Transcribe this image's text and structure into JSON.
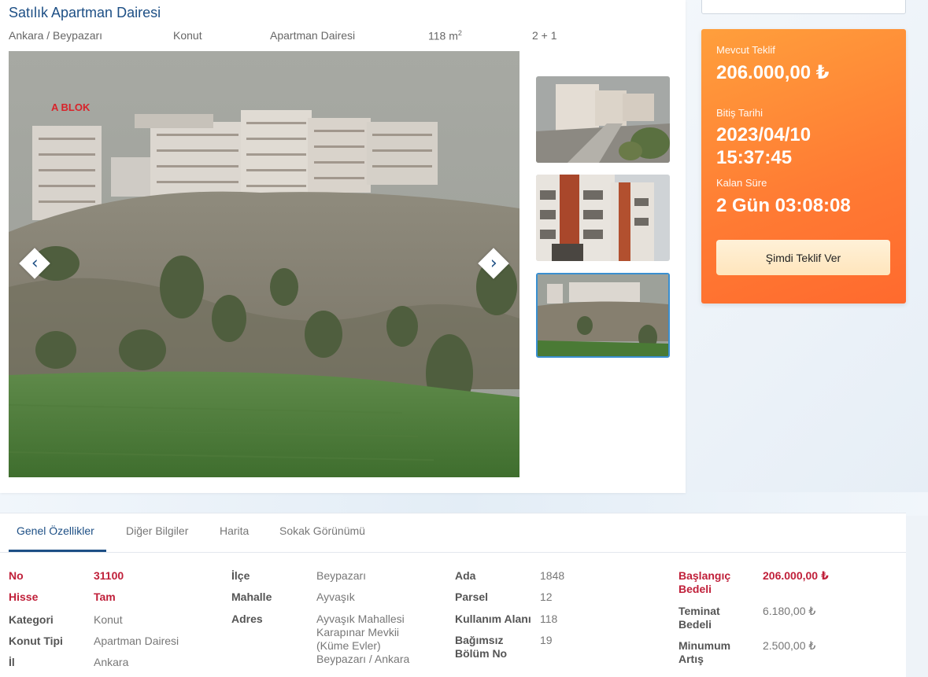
{
  "listing": {
    "title": "Satılık Apartman Dairesi",
    "location": "Ankara / Beypazarı",
    "type": "Konut",
    "subtype": "Apartman Dairesi",
    "area_number": "118 m",
    "area_sup": "2",
    "rooms": "2 + 1"
  },
  "gallery": {
    "photo_sign": "A BLOK",
    "thumbnails": 3,
    "active_thumbnail": 3
  },
  "offer": {
    "current_label": "Mevcut Teklif",
    "current_value": "206.000,00 ₺",
    "end_label": "Bitiş Tarihi",
    "end_date": "2023/04/10",
    "end_time": "15:37:45",
    "remaining_label": "Kalan Süre",
    "remaining_value": "2 Gün 03:08:08",
    "button_label": "Şimdi Teklif Ver"
  },
  "tabs": [
    "Genel Özellikler",
    "Diğer Bilgiler",
    "Harita",
    "Sokak Görünümü"
  ],
  "properties": {
    "col1": [
      {
        "key": "No",
        "value": "31100"
      },
      {
        "key": "Hisse",
        "value": "Tam"
      },
      {
        "key": "Kategori",
        "value": "Konut"
      },
      {
        "key": "Konut Tipi",
        "value": "Apartman Dairesi"
      },
      {
        "key": "İl",
        "value": "Ankara"
      }
    ],
    "col2": [
      {
        "key": "İlçe",
        "value": "Beypazarı"
      },
      {
        "key": "Mahalle",
        "value": "Ayvaşık"
      },
      {
        "key": "Adres",
        "value_lines": [
          "Ayvaşık Mahallesi",
          "Karapınar Mevkii",
          "(Küme Evler)",
          "Beypazarı / Ankara"
        ]
      }
    ],
    "col3": [
      {
        "key": "Ada",
        "value": "1848"
      },
      {
        "key": "Parsel",
        "value": "12"
      },
      {
        "key": "Kullanım Alanı",
        "value": "118"
      },
      {
        "key_lines": [
          "Bağımsız",
          "Bölüm No"
        ],
        "value": "19"
      }
    ],
    "col4": [
      {
        "key_lines": [
          "Başlangıç",
          "Bedeli"
        ],
        "value": "206.000,00 ₺"
      },
      {
        "key_lines": [
          "Teminat",
          "Bedeli"
        ],
        "value": "6.180,00 ₺"
      },
      {
        "key_lines": [
          "Minumum",
          "Artış"
        ],
        "value": "2.500,00 ₺"
      }
    ]
  },
  "colors": {
    "title_blue": "#1d4f85",
    "offer_orange": "#ff7a33",
    "highlight_red": "#c0203a"
  }
}
